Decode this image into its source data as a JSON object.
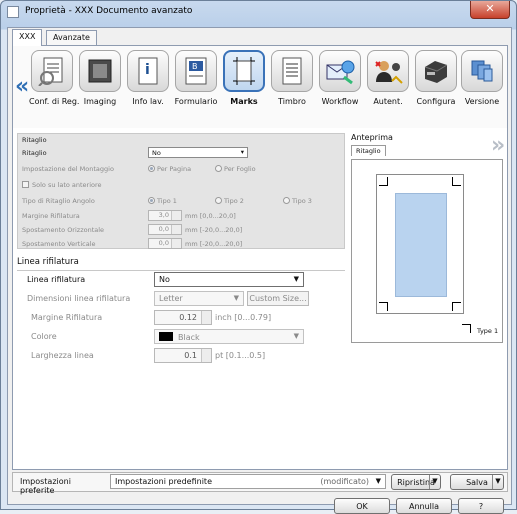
{
  "window": {
    "title": "Proprietà - XXX Documento avanzato",
    "close": "✕"
  },
  "tabs": [
    "XXX",
    "Avanzate"
  ],
  "nav": {
    "left": "«",
    "right": "»"
  },
  "toolbar": [
    {
      "label": "Conf. di Reg.",
      "icon": "registration-icon"
    },
    {
      "label": "Imaging",
      "icon": "imaging-icon"
    },
    {
      "label": "Info lav.",
      "icon": "job-info-icon"
    },
    {
      "label": "Formulario",
      "icon": "form-icon"
    },
    {
      "label": "Marks",
      "icon": "marks-icon"
    },
    {
      "label": "Timbro",
      "icon": "stamp-icon"
    },
    {
      "label": "Workflow",
      "icon": "workflow-icon"
    },
    {
      "label": "Autent.",
      "icon": "auth-icon"
    },
    {
      "label": "Configura",
      "icon": "configure-icon"
    },
    {
      "label": "Versione",
      "icon": "version-icon"
    }
  ],
  "ritaglio": {
    "header": "Ritaglio",
    "ritaglio_label": "Ritaglio",
    "ritaglio_value": "No",
    "montaggio_label": "Impostazione del Montaggio",
    "montaggio_opt1": "Per Pagina",
    "montaggio_opt2": "Per Foglio",
    "solo_label": "Solo su lato anteriore",
    "tipo_label": "Tipo di Ritaglio Angolo",
    "tipo1": "Tipo 1",
    "tipo2": "Tipo 2",
    "tipo3": "Tipo 3",
    "margine_label": "Margine Rifilatura",
    "margine_value": "3,0",
    "margine_unit": "mm [0,0...20,0]",
    "orizz_label": "Spostamento Orizzontale",
    "orizz_value": "0,0",
    "orizz_unit": "mm [-20,0...20,0]",
    "vert_label": "Spostamento Verticale",
    "vert_value": "0,0",
    "vert_unit": "mm [-20,0...20,0]"
  },
  "linea": {
    "header": "Linea rifilatura",
    "linea_label": "Linea rifilatura",
    "linea_value": "No",
    "dim_label": "Dimensioni linea rifilatura",
    "dim_value": "Letter",
    "custom_btn": "Custom Size...",
    "margine_label": "Margine Rifilatura",
    "margine_value": "0.12",
    "margine_unit": "inch [0...0.79]",
    "colore_label": "Colore",
    "colore_value": "Black",
    "largh_label": "Larghezza linea",
    "largh_value": "0.1",
    "largh_unit": "pt [0.1...0.5]"
  },
  "anteprima": {
    "header": "Anteprima",
    "tab": "Ritaglio",
    "legend": "Type 1"
  },
  "bottom": {
    "pref_label": "Impostazioni preferite",
    "pref_value": "Impostazioni predefinite",
    "modified": "(modificato)",
    "restore": "Ripristina",
    "save": "Salva",
    "ok": "OK",
    "cancel": "Annulla",
    "help": "?"
  }
}
